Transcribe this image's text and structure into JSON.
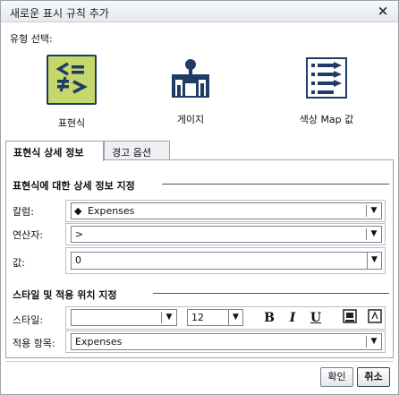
{
  "dialog": {
    "title": "새로운 표시 규칙 추가",
    "close": "×"
  },
  "type_section": {
    "label": "유형 선택:",
    "options": [
      {
        "label": "표현식",
        "icon": "expression-icon",
        "selected": true
      },
      {
        "label": "게이지",
        "icon": "gauge-icon",
        "selected": false
      },
      {
        "label": "색상 Map 값",
        "icon": "color-map-icon",
        "selected": false
      }
    ]
  },
  "tabs": [
    {
      "label": "표현식 상세 정보",
      "active": true
    },
    {
      "label": "경고 옵션",
      "active": false
    }
  ],
  "details": {
    "section_title": "표현식에 대한 상세 정보 지정",
    "column_label": "칼럼:",
    "column_value": "Expenses",
    "operator_label": "연산자:",
    "operator_value": ">",
    "value_label": "값:",
    "value_value": "0"
  },
  "style": {
    "section_title": "스타일 및 적용 위치 지정",
    "style_label": "스타일:",
    "font_value": "",
    "size_value": "12",
    "bold": "B",
    "italic": "I",
    "underline": "U",
    "apply_label": "적용 항목:",
    "apply_value": "Expenses"
  },
  "buttons": {
    "ok": "확인",
    "cancel": "취소"
  },
  "colors": {
    "accent_green": "#c6d86b",
    "icon_navy": "#1f3b66"
  }
}
